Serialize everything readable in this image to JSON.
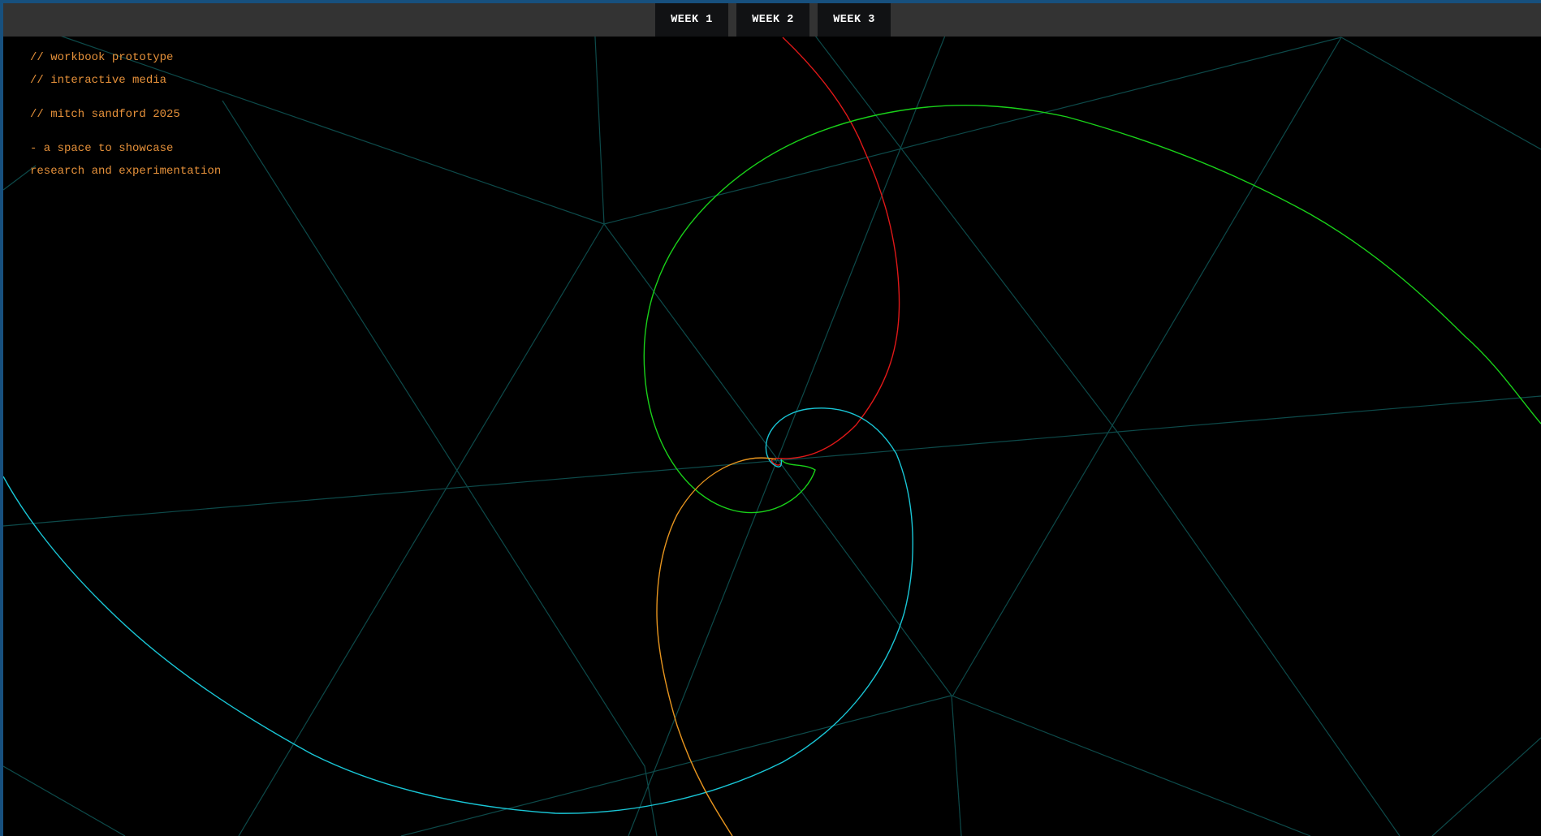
{
  "nav": {
    "items": [
      {
        "label": "WEEK 1"
      },
      {
        "label": "WEEK 2"
      },
      {
        "label": "WEEK 3"
      }
    ]
  },
  "intro": {
    "line1": "// workbook prototype",
    "line2": "// interactive media",
    "line3": "// mitch sandford 2025",
    "line4": "- a space to showcase",
    "line5": "research and experimentation"
  },
  "colors": {
    "page_border": "#17507e",
    "topbar": "#333333",
    "nav_button": "#111214",
    "intro_text": "#e6913a",
    "mesh": "#0d4a4a",
    "spiral_red": "#e01818",
    "spiral_green": "#19d119",
    "spiral_cyan": "#19c6d6",
    "spiral_orange": "#e8951e"
  }
}
